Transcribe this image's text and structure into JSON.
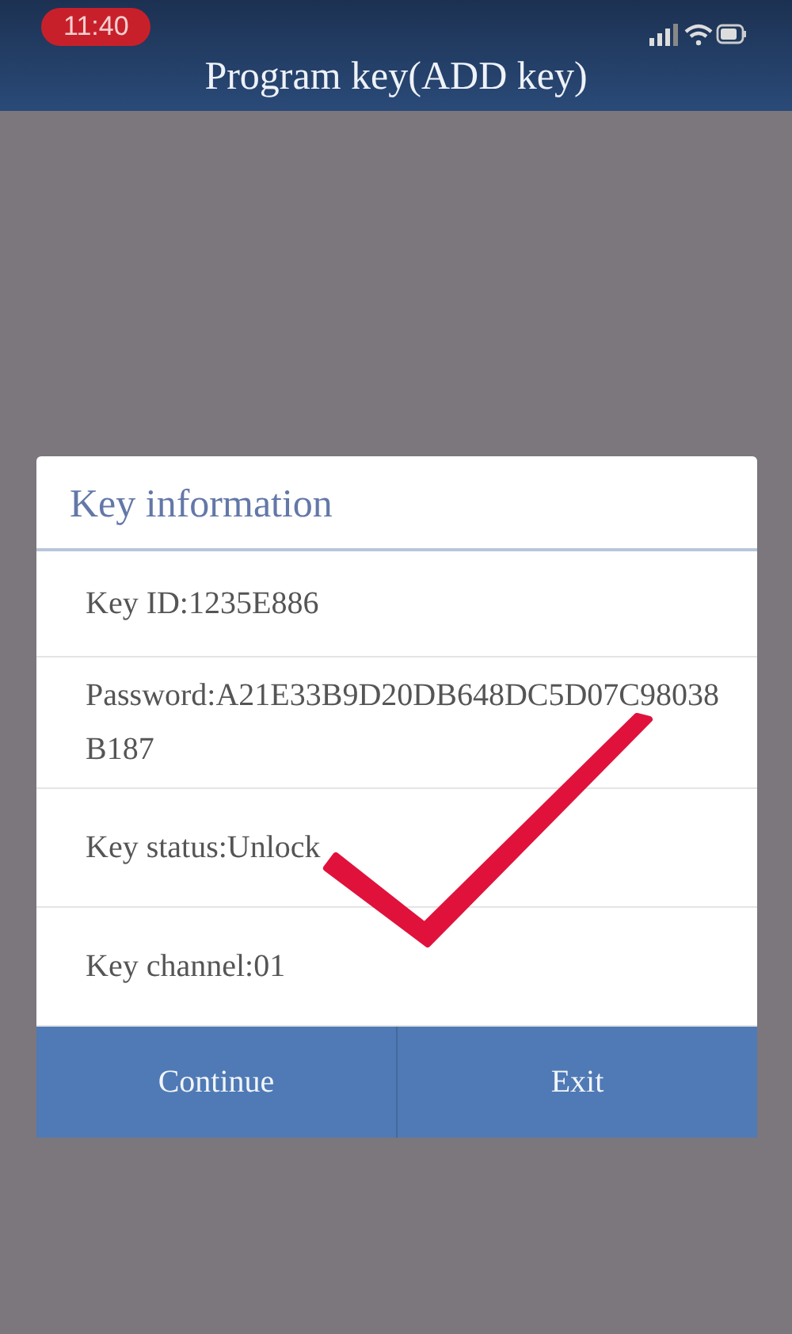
{
  "status_bar": {
    "time": "11:40"
  },
  "header": {
    "title": "Program key(ADD key)"
  },
  "dialog": {
    "title": "Key information",
    "rows": [
      "Key ID:1235E886",
      "Password:A21E33B9D20DB648DC5D07C98038B187",
      "Key status:Unlock",
      "Key channel:01"
    ],
    "buttons": [
      "Continue",
      "Exit"
    ]
  }
}
